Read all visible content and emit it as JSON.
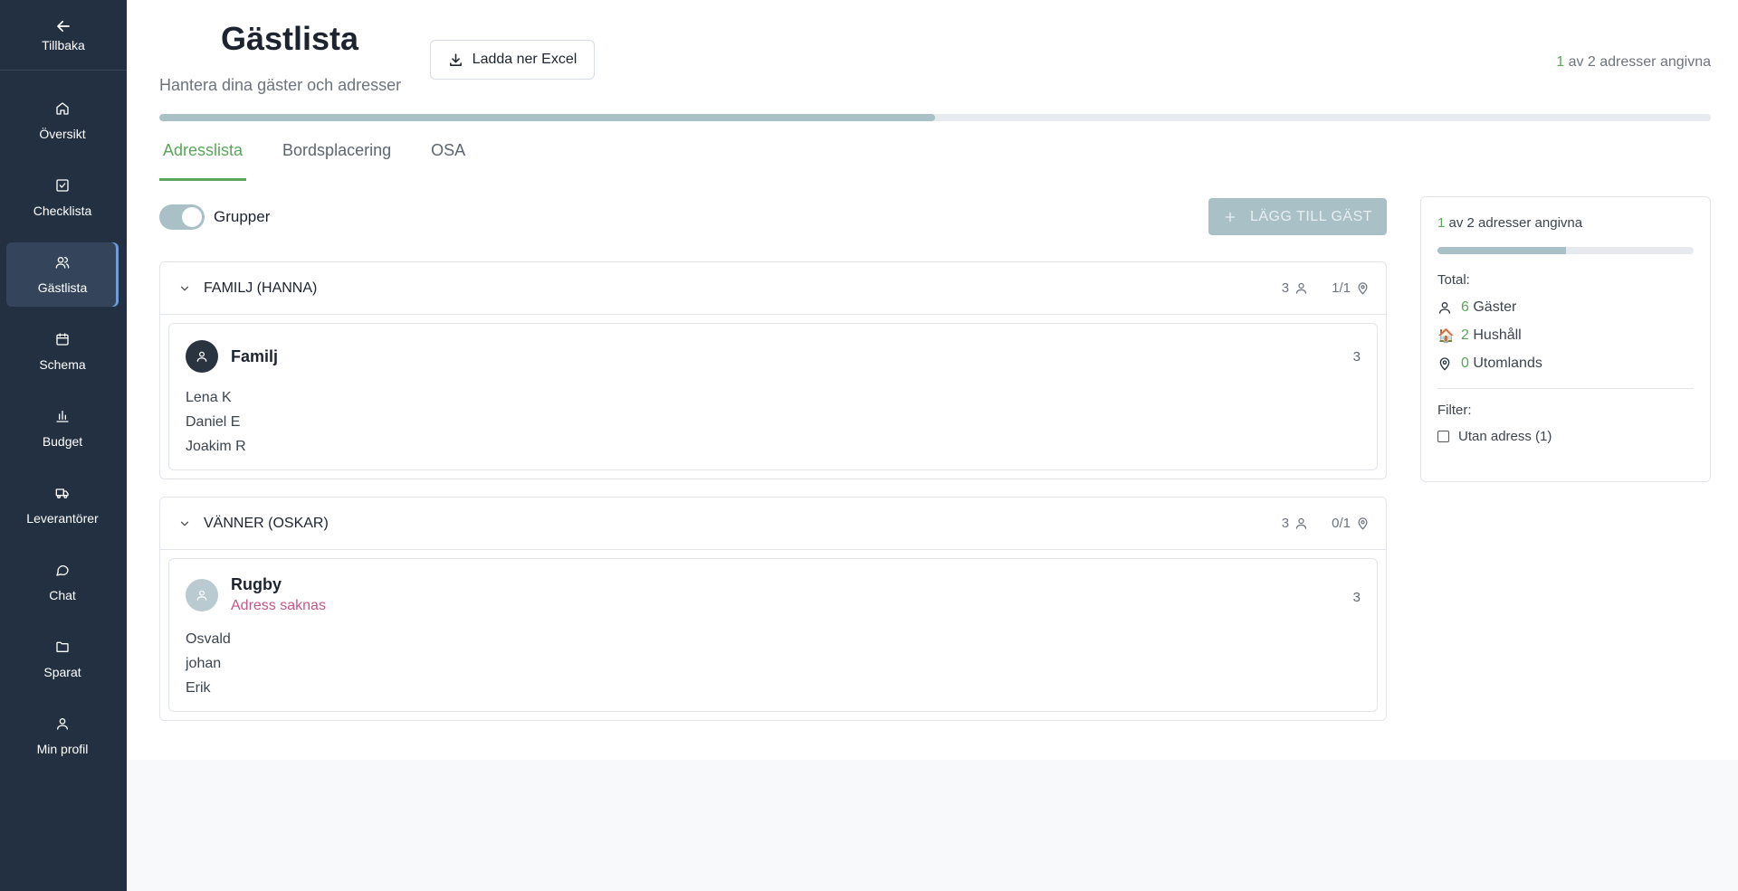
{
  "sidebar": {
    "back_label": "Tillbaka",
    "items": [
      {
        "label": "Översikt",
        "icon": "home-icon"
      },
      {
        "label": "Checklista",
        "icon": "checkbox-icon"
      },
      {
        "label": "Gästlista",
        "icon": "users-icon",
        "active": true
      },
      {
        "label": "Schema",
        "icon": "calendar-icon"
      },
      {
        "label": "Budget",
        "icon": "bar-chart-icon"
      },
      {
        "label": "Leverantörer",
        "icon": "truck-icon"
      },
      {
        "label": "Chat",
        "icon": "chat-icon"
      },
      {
        "label": "Sparat",
        "icon": "folder-icon"
      },
      {
        "label": "Min profil",
        "icon": "user-icon"
      }
    ]
  },
  "header": {
    "title": "Gästlista",
    "subtitle": "Hantera dina gäster och adresser",
    "excel_label": "Ladda ner Excel",
    "count_num": "1",
    "count_text": " av 2 adresser angivna",
    "progress": 0.5
  },
  "tabs": [
    "Adresslista",
    "Bordsplacering",
    "OSA"
  ],
  "toolbar": {
    "toggle_label": "Grupper",
    "add_label": "LÄGG TILL GÄST"
  },
  "groups": [
    {
      "name": "FAMILJ (HANNA)",
      "guest_count": "3",
      "address_ratio": "1/1",
      "household": {
        "name": "Familj",
        "warning": "",
        "count": "3",
        "members": [
          "Lena K",
          "Daniel E",
          "Joakim R"
        ]
      }
    },
    {
      "name": "VÄNNER (OSKAR)",
      "guest_count": "3",
      "address_ratio": "0/1",
      "household": {
        "name": "Rugby",
        "warning": "Adress saknas",
        "count": "3",
        "members": [
          "Osvald",
          "johan",
          "Erik"
        ]
      }
    }
  ],
  "summary": {
    "count_num": "1",
    "count_text": " av 2 adresser angivna",
    "progress": 0.5,
    "total_label": "Total:",
    "guests_num": "6",
    "guests_label": "Gäster",
    "households_num": "2",
    "households_label": "Hushåll",
    "abroad_num": "0",
    "abroad_label": "Utomlands",
    "filter_label": "Filter:",
    "filter_option": "Utan adress (1)"
  },
  "colors": {
    "accent": "#5aa65a",
    "sidebar": "#233041",
    "progress": "#a9c0c6",
    "warning": "#c2578a"
  }
}
